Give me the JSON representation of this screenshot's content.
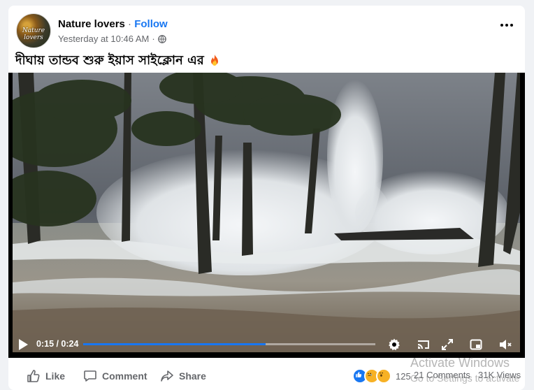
{
  "post": {
    "page_name": "Nature lovers",
    "separator": "·",
    "follow_label": "Follow",
    "timestamp": "Yesterday at 10:46 AM",
    "meta_dot": "·",
    "avatar_text": "Nature lovers",
    "caption": "দীঘায় তান্ডব শুরু ইয়াস সাইক্লোন এর",
    "caption_emoji": "fire-icon"
  },
  "video": {
    "time_display": "0:15 / 0:24",
    "progress": 0.625,
    "controls": [
      "play-icon",
      "settings-icon",
      "cast-icon",
      "fullscreen-icon",
      "miniplayer-icon",
      "muted-volume-icon"
    ]
  },
  "actions": {
    "like_label": "Like",
    "comment_label": "Comment",
    "share_label": "Share"
  },
  "stats": {
    "reactions": [
      "like",
      "sad",
      "wow"
    ],
    "reaction_count": "125",
    "comments": "21 Comments",
    "views": "31K Views"
  },
  "watermark": {
    "title": "Activate Windows",
    "subtitle": "Go to Settings to activate"
  },
  "colors": {
    "accent": "#1877f2",
    "secondary_text": "#65676b",
    "background": "#f0f2f5"
  }
}
